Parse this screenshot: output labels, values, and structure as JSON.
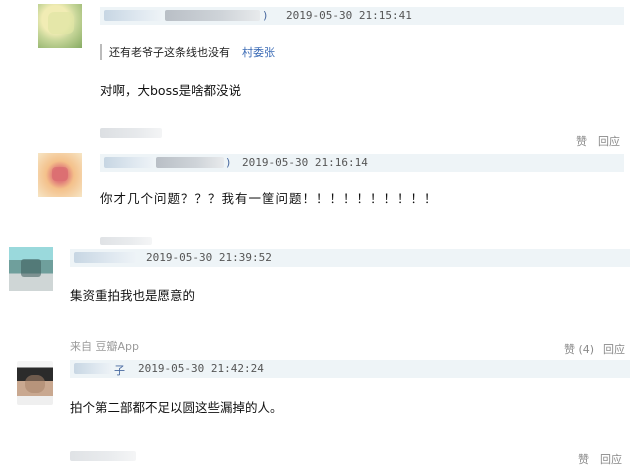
{
  "comments": [
    {
      "id": "c1",
      "name_suffix": ")",
      "timestamp": "2019-05-30 21:15:41",
      "quote": {
        "text": "还有老爷子这条线也没有",
        "author": "村委张"
      },
      "text": "对啊，大boss是啥都没说",
      "actions": {
        "like": "赞",
        "reply": "回应"
      },
      "avatar_icon": "blurred-avatar-icon",
      "avatar_colors": [
        "#e9e3a8",
        "#b9cf8f",
        "#7fa35b"
      ]
    },
    {
      "id": "c2",
      "name_suffix": ")",
      "timestamp": "2019-05-30 21:16:14",
      "text": "你才几个问题？？？我有一筐问题！！！！！！！！！！",
      "avatar_icon": "blurred-avatar-icon",
      "avatar_colors": [
        "#f6c48a",
        "#e8897a",
        "#f3e4c8"
      ]
    },
    {
      "id": "c3",
      "timestamp": "2019-05-30 21:39:52",
      "text": "集资重拍我也是愿意的",
      "source": "来自 豆瓣App",
      "actions": {
        "like": "赞 (4)",
        "reply": "回应"
      },
      "avatar_icon": "blurred-avatar-icon",
      "avatar_colors": [
        "#8fd0d4",
        "#5f8f8f",
        "#d9d9d9"
      ]
    },
    {
      "id": "c4",
      "name_suffix": "子",
      "timestamp": "2019-05-30 21:42:24",
      "text": "拍个第二部都不足以圆这些漏掉的人。",
      "actions": {
        "like": "赞",
        "reply": "回应"
      },
      "avatar_icon": "blurred-avatar-icon",
      "avatar_colors": [
        "#2b2b2b",
        "#c9a890",
        "#f3f3f3"
      ]
    }
  ]
}
